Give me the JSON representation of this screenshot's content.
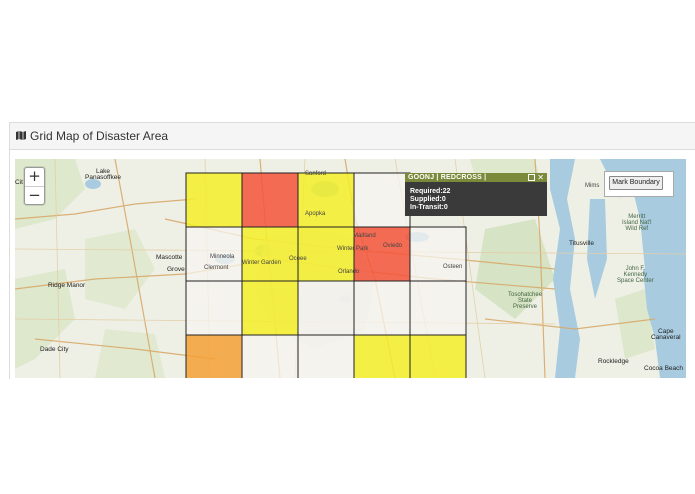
{
  "panel": {
    "title": "Grid Map of Disaster Area",
    "icon": "map-icon"
  },
  "zoom": {
    "in": "+",
    "out": "−"
  },
  "mark_boundary": {
    "label": "Mark Boundary"
  },
  "popup": {
    "title": "GOONJ | REDCROSS |",
    "required": "Required:22",
    "supplied": "Supplied:0",
    "in_transit": "In-Transit:0"
  },
  "grid": {
    "rows": [
      [
        "yellow",
        "red",
        "yellow",
        "white"
      ],
      [
        "white",
        "yellow",
        "yellow",
        "red",
        "white"
      ],
      [
        "white",
        "yellow",
        "white",
        "white",
        "white"
      ],
      [
        "orange",
        "white",
        "white",
        "yellow",
        "yellow"
      ]
    ]
  },
  "colors": {
    "red": "#f5543a",
    "yellow": "#f5ef28",
    "orange": "#f4a035",
    "white": "#f7f4ef",
    "water": "#a8cbe0",
    "land": "#eef0e6"
  },
  "map_labels": {
    "lake_panasoffkee": "Lake\nPanasoffkee",
    "mascotte": "Mascotte",
    "groveland": "Grove",
    "ridge_manor": "Ridge Manor",
    "dade_city": "Dade City",
    "titusville": "Titusville",
    "merritt_island": "Merritt\nIsland Nat'l\nWild Ref",
    "john_f_kennedy": "John F.\nKennedy\nSpace Center",
    "cape_canaveral": "Cape\nCanaveral",
    "rockledge": "Rockledge",
    "cocoa_beach": "Cocoa Beach",
    "tosohatchee": "Tosohatchee\nState\nPreserve",
    "apopka": "Apopka",
    "winter_garden": "Winter Garden",
    "ocoee": "Ocoee",
    "orlando": "Orlando",
    "winter_park": "Winter Park",
    "maitland": "Maitland",
    "oviedo": "Oviedo",
    "sanford": "Sanford",
    "minneola": "Minneola",
    "clermont": "Clermont",
    "citrus": "Cit",
    "osteen": "Osteen",
    "mims": "Mims"
  }
}
